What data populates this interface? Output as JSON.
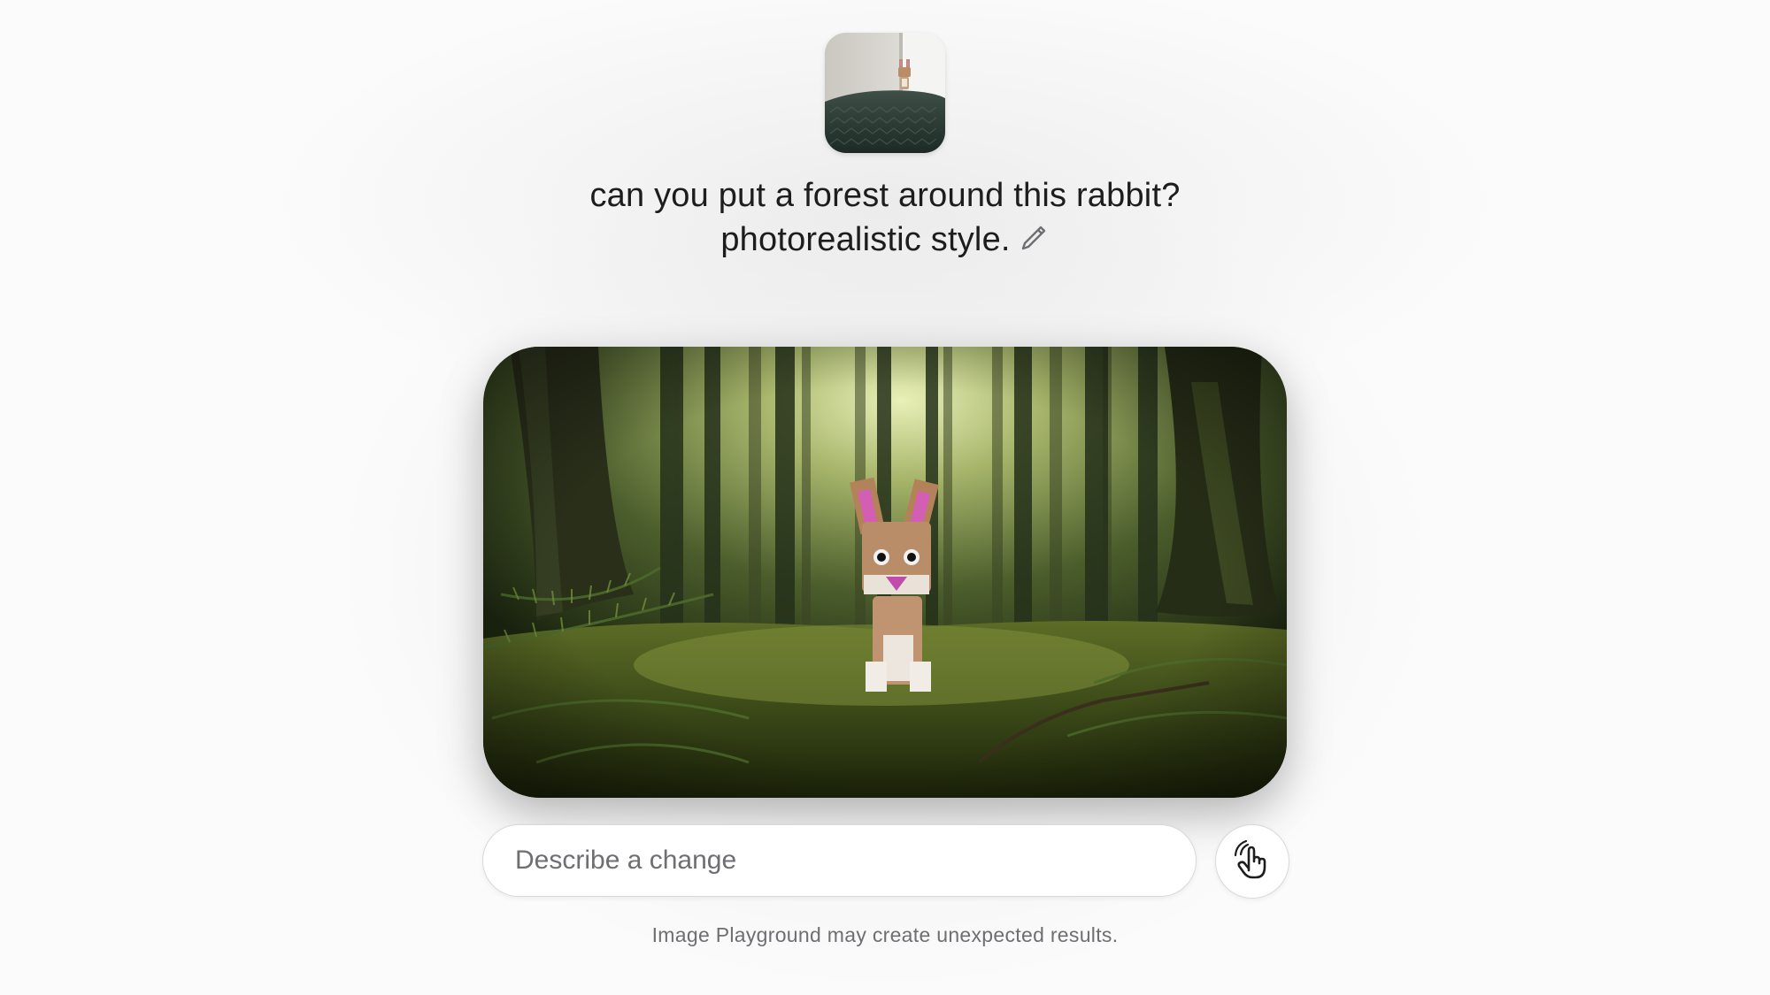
{
  "source_image": {
    "alt": "source-photo-thumbnail"
  },
  "prompt": {
    "line1": "can you put a forest around this rabbit?",
    "line2": "photorealistic style."
  },
  "result_image": {
    "alt": "generated-forest-rabbit-image"
  },
  "describe_input": {
    "placeholder": "Describe a change",
    "value": ""
  },
  "disclaimer": "Image Playground may create unexpected results.",
  "icons": {
    "edit": "pencil-icon",
    "gesture": "finger-point-icon"
  },
  "colors": {
    "text_primary": "#1d1d1f",
    "text_secondary": "#6e6e73",
    "border": "#d9d9d9",
    "background": "#fbfbfb"
  }
}
